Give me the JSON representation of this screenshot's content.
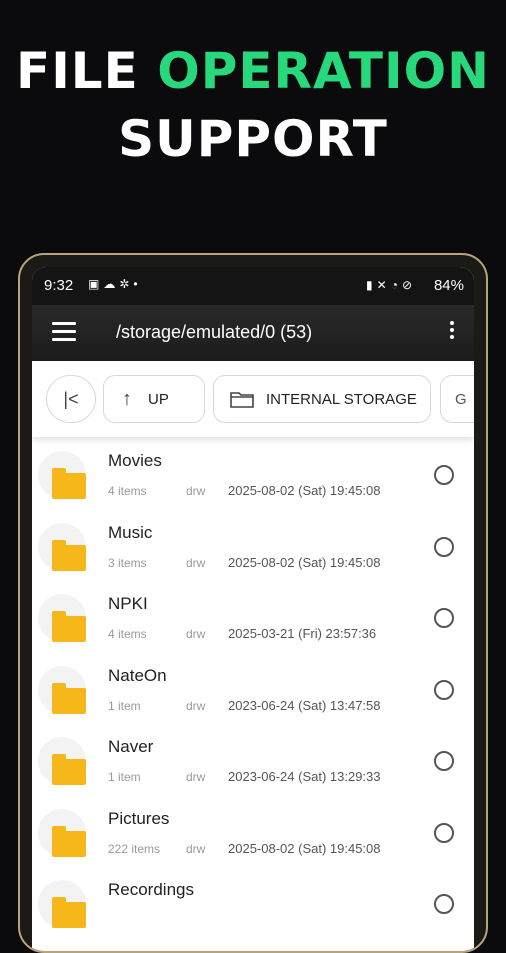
{
  "headline": {
    "line1_plain": "FILE",
    "line1_accent": "OPERATION",
    "line2": "SUPPORT",
    "accent_color": "#27d97c"
  },
  "statusbar": {
    "time": "9:32",
    "left_icons": [
      "notification-check-icon",
      "cloud-icon",
      "gear-icon",
      "dot-icon"
    ],
    "right_icons": [
      "battery-saver-icon",
      "mute-icon",
      "wifi-icon",
      "dnd-icon"
    ],
    "battery": "84%"
  },
  "appbar": {
    "path": "/storage/emulated/0  (53)"
  },
  "nav": {
    "first_label": "|<",
    "up_label": "UP",
    "storage_label": "INTERNAL STORAGE",
    "more_label": "G"
  },
  "files": [
    {
      "name": "Movies",
      "count": "4 items",
      "perm": "drw",
      "date": "2025-08-02 (Sat) 19:45:08"
    },
    {
      "name": "Music",
      "count": "3 items",
      "perm": "drw",
      "date": "2025-08-02 (Sat) 19:45:08"
    },
    {
      "name": "NPKI",
      "count": "4 items",
      "perm": "drw",
      "date": "2025-03-21 (Fri) 23:57:36"
    },
    {
      "name": "NateOn",
      "count": "1 item",
      "perm": "drw",
      "date": "2023-06-24 (Sat) 13:47:58"
    },
    {
      "name": "Naver",
      "count": "1 item",
      "perm": "drw",
      "date": "2023-06-24 (Sat) 13:29:33"
    },
    {
      "name": "Pictures",
      "count": "222 items",
      "perm": "drw",
      "date": "2025-08-02 (Sat) 19:45:08"
    },
    {
      "name": "Recordings",
      "count": "",
      "perm": "",
      "date": ""
    }
  ]
}
